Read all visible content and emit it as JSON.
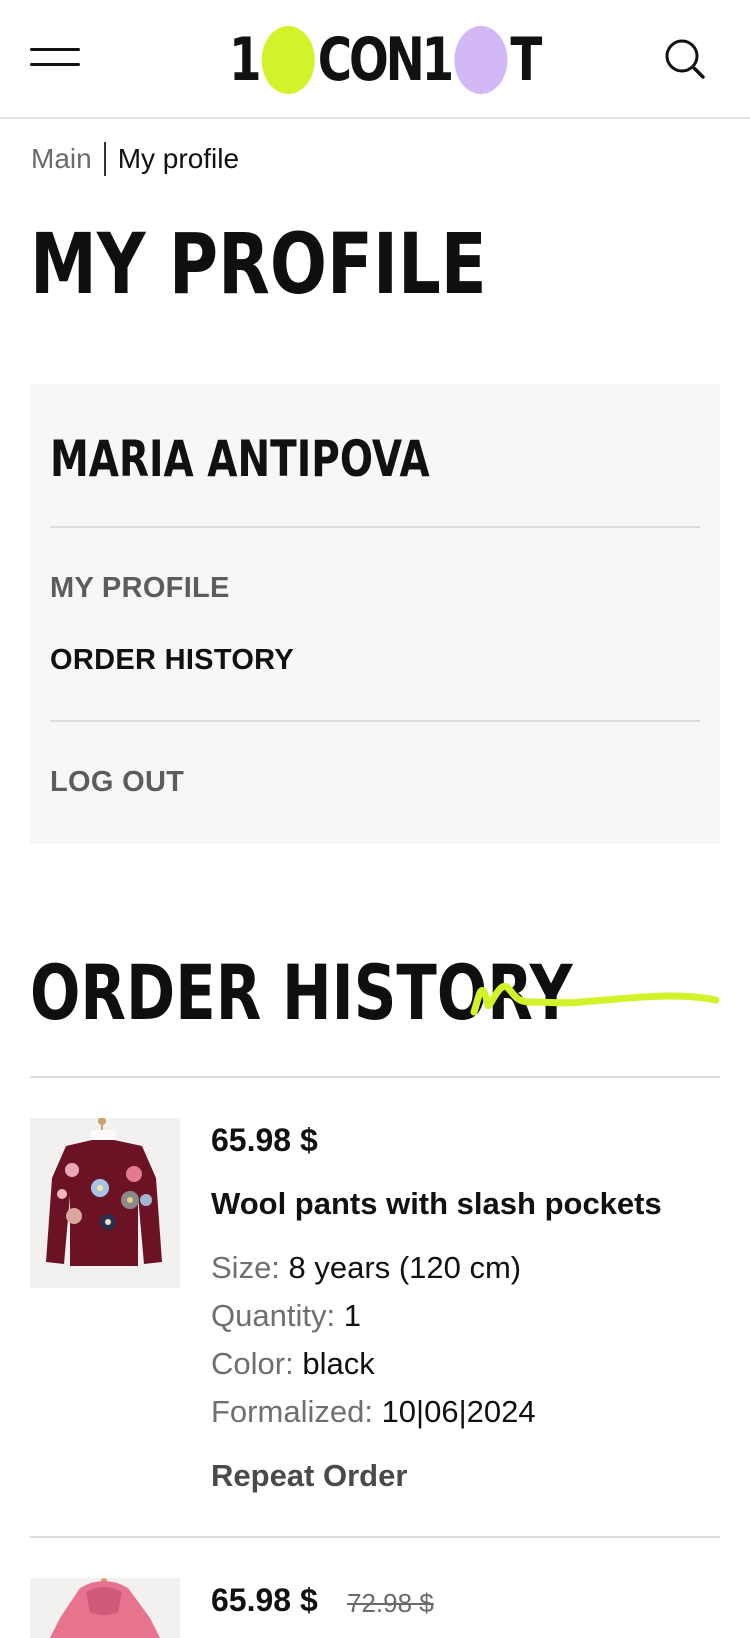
{
  "header": {
    "logo": {
      "part1": "1",
      "part2": "CON1",
      "part3": "T",
      "dot_colors": [
        "#d4f22a",
        "#d2b8f5"
      ]
    },
    "menu_icon": "hamburger-menu-icon",
    "search_icon": "search-icon"
  },
  "breadcrumb": {
    "items": [
      "Main",
      "My profile"
    ]
  },
  "page": {
    "title": "MY PROFILE"
  },
  "profile_card": {
    "user_name": "MARIA ANTIPOVA",
    "links": {
      "my_profile": "MY PROFILE",
      "order_history": "ORDER HISTORY",
      "logout": "LOG OUT"
    },
    "active_link": "order_history"
  },
  "order_history": {
    "title": "ORDER HISTORY",
    "accent_color": "#d4f22a",
    "orders": [
      {
        "price": "65.98 $",
        "name": "Wool pants with slash pockets",
        "image": "burgundy-flower-sweater",
        "attributes": [
          {
            "label": "Size:",
            "value": "8 years (120 cm)"
          },
          {
            "label": "Quantity:",
            "value": "1"
          },
          {
            "label": "Color:",
            "value": "black"
          },
          {
            "label": "Formalized:",
            "value": "10|06|2024"
          }
        ],
        "repeat_label": "Repeat Order"
      },
      {
        "price": "65.98 $",
        "old_price": "72.98 $",
        "image": "pink-hooded-jacket"
      }
    ]
  }
}
